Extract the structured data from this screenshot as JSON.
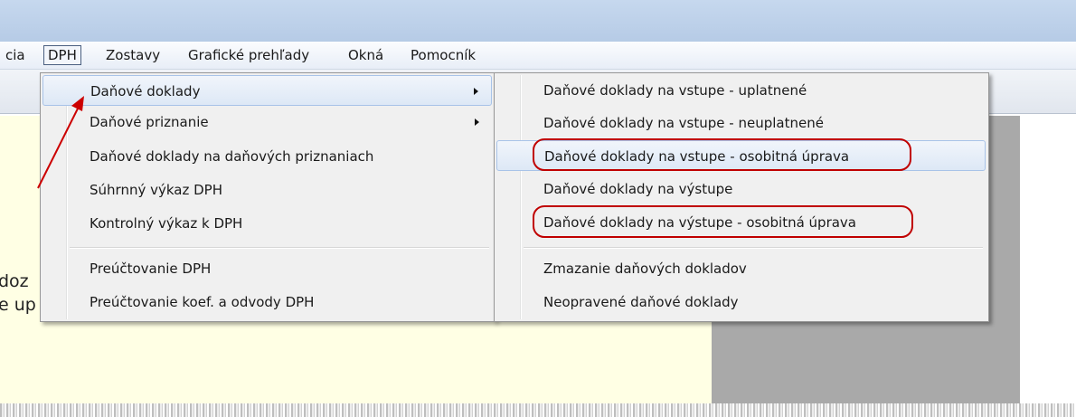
{
  "menubar": {
    "items": [
      "cia",
      "DPH",
      "Zostavy",
      "Grafické prehľady",
      "Okná",
      "Pomocník"
    ],
    "active": "DPH"
  },
  "background": {
    "partial_text_1": "doz",
    "partial_text_2": "e up"
  },
  "dph_menu": {
    "items": [
      {
        "label": "Daňové doklady",
        "has_submenu": true
      },
      {
        "label": "Daňové priznanie",
        "has_submenu": true
      },
      {
        "label": "Daňové doklady na daňových priznaniach",
        "has_submenu": false
      },
      {
        "label": "Súhrnný výkaz DPH",
        "has_submenu": false
      },
      {
        "label": "Kontrolný výkaz k DPH",
        "has_submenu": false
      },
      {
        "label": "Preúčtovanie DPH",
        "has_submenu": false
      },
      {
        "label": "Preúčtovanie koef. a odvody DPH",
        "has_submenu": false
      }
    ]
  },
  "submenu": {
    "items": [
      {
        "label": "Daňové doklady na vstupe - uplatnené"
      },
      {
        "label": "Daňové doklady na vstupe - neuplatnené"
      },
      {
        "label": "Daňové doklady na vstupe - osobitná úprava",
        "highlighted": true,
        "circled": true
      },
      {
        "label": "Daňové doklady na výstupe"
      },
      {
        "label": "Daňové doklady na výstupe - osobitná úprava",
        "circled": true
      },
      {
        "label": "Zmazanie daňových dokladov"
      },
      {
        "label": "Neopravené daňové doklady"
      }
    ]
  },
  "annotations": {
    "arrow_color": "#cc0000",
    "circle_color": "#c00000"
  }
}
